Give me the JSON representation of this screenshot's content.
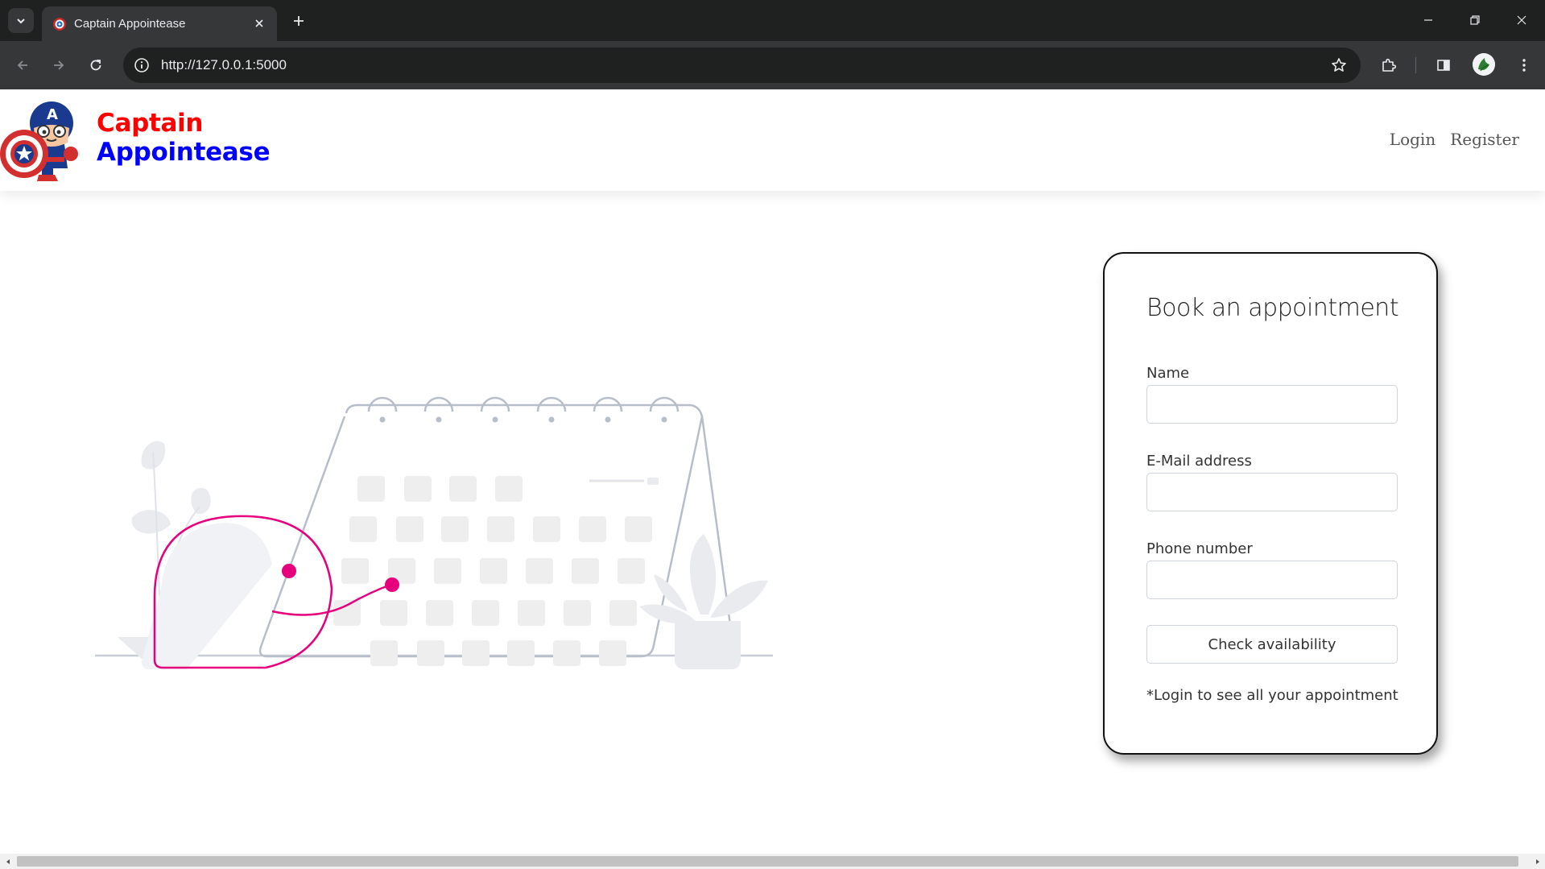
{
  "browser": {
    "tab_title": "Captain Appointease",
    "url": "http://127.0.0.1:5000",
    "icons": {
      "tab_search": "chevron-down-icon",
      "tab_close": "close-icon",
      "new_tab": "plus-icon",
      "back": "arrow-left-icon",
      "forward": "arrow-right-icon",
      "reload": "reload-icon",
      "site_info": "info-icon",
      "bookmark": "star-icon",
      "extensions": "puzzle-icon",
      "side_panel": "side-panel-icon",
      "menu": "kebab-menu-icon"
    }
  },
  "navbar": {
    "brand_line1": "Captain",
    "brand_line2": "Appointease",
    "links": [
      "Login",
      "Register"
    ],
    "colors": {
      "brand_red": "#ff0000",
      "brand_blue": "#0000ff"
    }
  },
  "illustration": {
    "accent_color": "#e6007e",
    "neutral_color": "#c7ccd6"
  },
  "booking": {
    "title": "Book an appointment",
    "fields": [
      {
        "label": "Name",
        "value": ""
      },
      {
        "label": "E-Mail address",
        "value": ""
      },
      {
        "label": "Phone number",
        "value": ""
      }
    ],
    "submit_label": "Check availability",
    "note": "*Login to see all your appointment"
  }
}
